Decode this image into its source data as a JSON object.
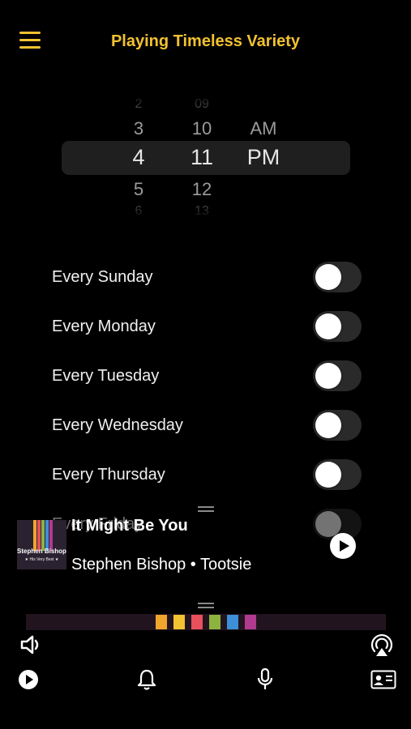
{
  "header": {
    "title": "Playing Timeless Variety"
  },
  "picker": {
    "hours": {
      "far_above": "2",
      "above": "3",
      "selected": "4",
      "below": "5",
      "far_below": "6"
    },
    "minutes": {
      "far_above": "09",
      "above": "10",
      "selected": "11",
      "below": "12",
      "far_below": "13"
    },
    "period": {
      "above": "AM",
      "selected": "PM"
    }
  },
  "repeat_days": [
    {
      "label": "Every Sunday",
      "on": false
    },
    {
      "label": "Every Monday",
      "on": false
    },
    {
      "label": "Every Tuesday",
      "on": false
    },
    {
      "label": "Every Wednesday",
      "on": false
    },
    {
      "label": "Every Thursday",
      "on": false
    },
    {
      "label": "Every Friday",
      "on": false
    }
  ],
  "now_playing": {
    "title": "It Might Be You",
    "artist_album": "Stephen Bishop • Tootsie",
    "album_art": {
      "title": "Stephen Bishop",
      "subtitle": "★ His Very Best ★"
    }
  },
  "spectrum_colors": [
    "#F0A52C",
    "#F2C230",
    "#E8505B",
    "#8DB33F",
    "#3D8FD8",
    "#B03A8F"
  ],
  "toolbar": {
    "volume_icon": "speaker-icon",
    "airplay_icon": "airplay-icon",
    "play_icon": "play-circle-icon",
    "alarm_icon": "bell-icon",
    "mic_icon": "microphone-icon",
    "contact_icon": "contact-card-icon"
  },
  "colors": {
    "accent": "#F2C230",
    "background": "#000000",
    "toggle_off": "#2a2a2a"
  }
}
